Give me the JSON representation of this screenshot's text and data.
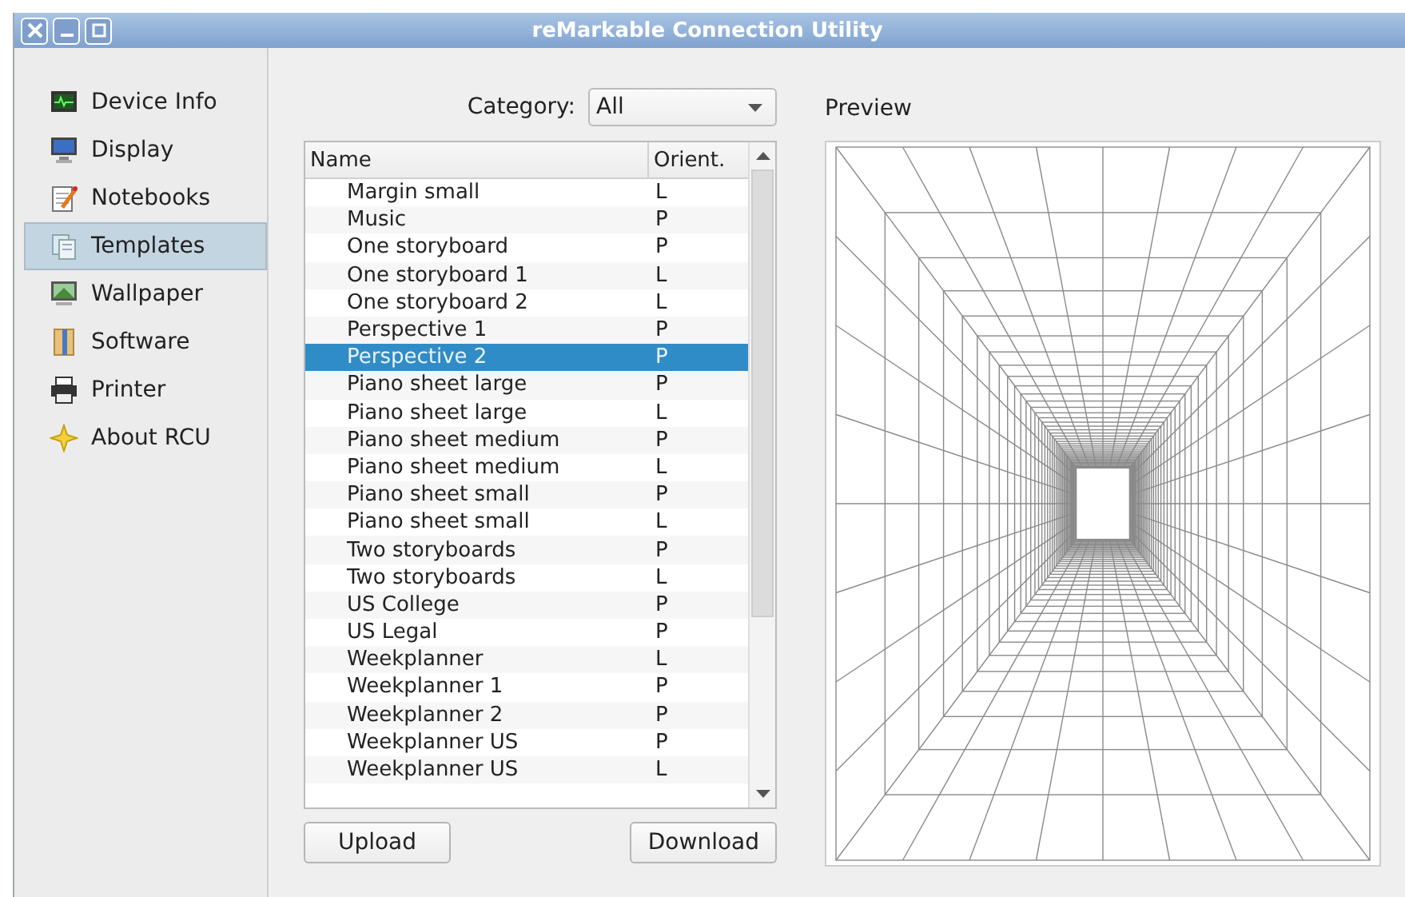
{
  "window": {
    "title": "reMarkable Connection Utility"
  },
  "sidebar": {
    "items": [
      {
        "label": "Device Info",
        "selected": false
      },
      {
        "label": "Display",
        "selected": false
      },
      {
        "label": "Notebooks",
        "selected": false
      },
      {
        "label": "Templates",
        "selected": true
      },
      {
        "label": "Wallpaper",
        "selected": false
      },
      {
        "label": "Software",
        "selected": false
      },
      {
        "label": "Printer",
        "selected": false
      },
      {
        "label": "About RCU",
        "selected": false
      }
    ]
  },
  "category": {
    "label": "Category:",
    "value": "All"
  },
  "table": {
    "columns": [
      "Name",
      "Orient."
    ],
    "rows": [
      {
        "name": "Margin small",
        "orient": "L",
        "selected": false
      },
      {
        "name": "Music",
        "orient": "P",
        "selected": false
      },
      {
        "name": "One storyboard",
        "orient": "P",
        "selected": false
      },
      {
        "name": "One storyboard 1",
        "orient": "L",
        "selected": false
      },
      {
        "name": "One storyboard 2",
        "orient": "L",
        "selected": false
      },
      {
        "name": "Perspective 1",
        "orient": "P",
        "selected": false
      },
      {
        "name": "Perspective 2",
        "orient": "P",
        "selected": true
      },
      {
        "name": "Piano sheet large",
        "orient": "P",
        "selected": false
      },
      {
        "name": "Piano sheet large",
        "orient": "L",
        "selected": false
      },
      {
        "name": "Piano sheet medium",
        "orient": "P",
        "selected": false
      },
      {
        "name": "Piano sheet medium",
        "orient": "L",
        "selected": false
      },
      {
        "name": "Piano sheet small",
        "orient": "P",
        "selected": false
      },
      {
        "name": "Piano sheet small",
        "orient": "L",
        "selected": false
      },
      {
        "name": "Two storyboards",
        "orient": "P",
        "selected": false
      },
      {
        "name": "Two storyboards",
        "orient": "L",
        "selected": false
      },
      {
        "name": "US College",
        "orient": "P",
        "selected": false
      },
      {
        "name": "US Legal",
        "orient": "P",
        "selected": false
      },
      {
        "name": "Weekplanner",
        "orient": "L",
        "selected": false
      },
      {
        "name": "Weekplanner 1",
        "orient": "P",
        "selected": false
      },
      {
        "name": "Weekplanner 2",
        "orient": "P",
        "selected": false
      },
      {
        "name": "Weekplanner US",
        "orient": "P",
        "selected": false
      },
      {
        "name": "Weekplanner US",
        "orient": "L",
        "selected": false
      }
    ]
  },
  "buttons": [
    "Upload",
    "Download"
  ],
  "preview": {
    "label": "Preview"
  }
}
